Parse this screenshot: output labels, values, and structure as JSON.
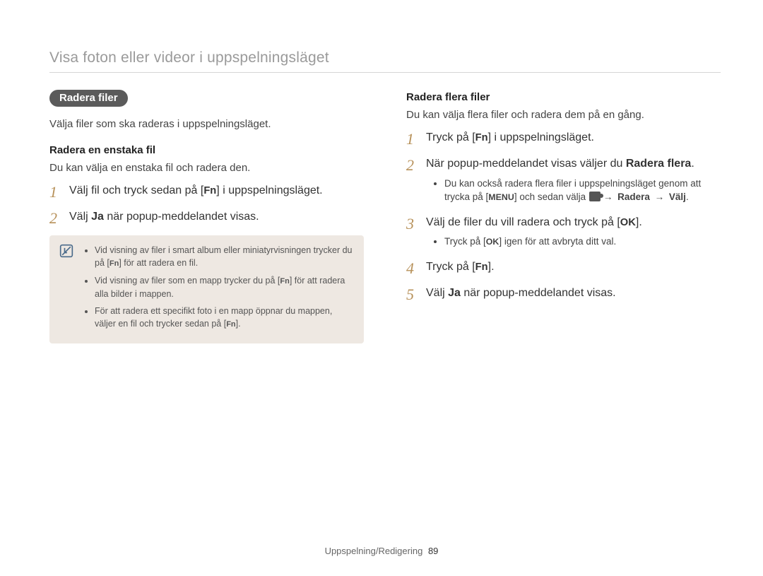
{
  "header": {
    "title": "Visa foton eller videor i uppspelningsläget"
  },
  "left": {
    "badge": "Radera filer",
    "intro": "Välja filer som ska raderas i uppspelningsläget.",
    "sub_heading": "Radera en enstaka fil",
    "sub_intro": "Du kan välja en enstaka fil och radera den.",
    "steps": {
      "s1_a": "Välj fil och tryck sedan på [",
      "s1_key": "Fn",
      "s1_b": "] i uppspelningsläget.",
      "s2_a": "Välj ",
      "s2_bold": "Ja",
      "s2_b": " när popup-meddelandet visas."
    },
    "note": {
      "b1_a": "Vid visning av filer i smart album eller miniatyrvisningen trycker du på [",
      "b1_key": "Fn",
      "b1_b": "] för att radera en fil.",
      "b2_a": "Vid visning av filer som en mapp trycker du på [",
      "b2_key": "Fn",
      "b2_b": "] för att radera alla bilder i mappen.",
      "b3_a": "För att radera ett specifikt foto i en mapp öppnar du mappen, väljer en fil och trycker sedan på [",
      "b3_key": "Fn",
      "b3_b": "]."
    }
  },
  "right": {
    "sub_heading": "Radera flera filer",
    "sub_intro": "Du kan välja flera filer och radera dem på en gång.",
    "steps": {
      "s1_a": "Tryck på [",
      "s1_key": "Fn",
      "s1_b": "] i uppspelningsläget.",
      "s2_a": "När popup-meddelandet visas väljer du ",
      "s2_bold": "Radera flera",
      "s2_b": ".",
      "s2_sub_a": "Du kan också radera flera filer i uppspelningsläget genom att trycka på [",
      "s2_sub_menu": "MENU",
      "s2_sub_b": "] och sedan välja ",
      "s2_sub_arrow1": "→",
      "s2_sub_radera": " Radera ",
      "s2_sub_arrow2": "→",
      "s2_sub_valj": " Välj",
      "s2_sub_c": ".",
      "s3_a": "Välj de filer du vill radera och tryck på [",
      "s3_key": "OK",
      "s3_b": "].",
      "s3_sub_a": "Tryck på [",
      "s3_sub_key": "OK",
      "s3_sub_b": "] igen för att avbryta ditt val.",
      "s4_a": "Tryck på [",
      "s4_key": "Fn",
      "s4_b": "].",
      "s5_a": "Välj ",
      "s5_bold": "Ja",
      "s5_b": " när popup-meddelandet visas."
    }
  },
  "footer": {
    "section": "Uppspelning/Redigering",
    "page": "89"
  }
}
